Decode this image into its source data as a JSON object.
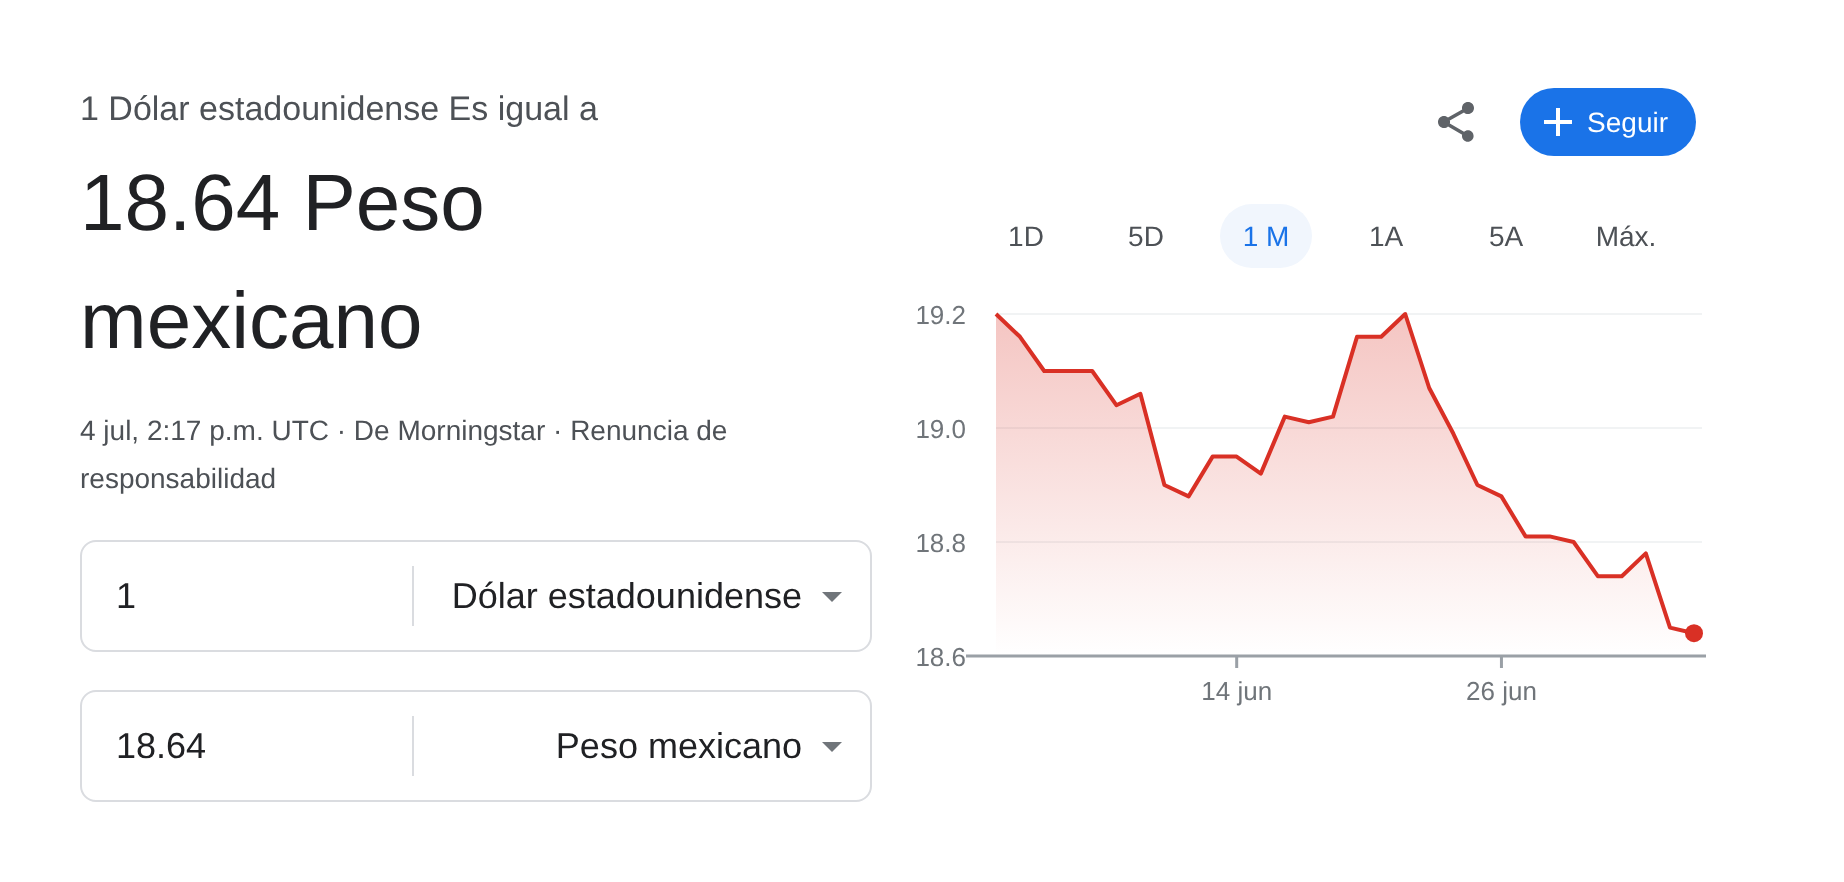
{
  "header": {
    "caption": "1 Dólar estadounidense Es igual a",
    "result": "18.64 Peso mexicano",
    "source": "4 jul, 2:17 p.m. UTC · De Morningstar · Renuncia de responsabilidad"
  },
  "follow_button": {
    "label": "Seguir"
  },
  "ranges": [
    {
      "label": "1D",
      "selected": false
    },
    {
      "label": "5D",
      "selected": false
    },
    {
      "label": "1 M",
      "selected": true
    },
    {
      "label": "1A",
      "selected": false
    },
    {
      "label": "5A",
      "selected": false
    },
    {
      "label": "Máx.",
      "selected": false
    }
  ],
  "converter": [
    {
      "value": "1",
      "currency": "Dólar estadounidense"
    },
    {
      "value": "18.64",
      "currency": "Peso mexicano"
    }
  ],
  "chart": {
    "chart_data": {
      "type": "area",
      "categories": [
        null,
        null,
        null,
        null,
        null,
        null,
        null,
        null,
        null,
        null,
        "14 jun",
        null,
        null,
        null,
        null,
        null,
        null,
        null,
        null,
        null,
        null,
        "26 jun",
        null,
        null,
        null,
        null,
        null,
        null,
        null,
        null
      ],
      "series": [
        {
          "color": "#d93025",
          "values": [
            19.2,
            19.16,
            19.1,
            19.1,
            19.1,
            19.04,
            19.06,
            18.9,
            18.88,
            18.95,
            18.95,
            18.92,
            19.02,
            19.01,
            19.02,
            19.16,
            19.16,
            19.2,
            19.07,
            18.99,
            18.9,
            18.88,
            18.81,
            18.81,
            18.8,
            18.74,
            18.74,
            18.78,
            18.65,
            18.64
          ]
        }
      ],
      "ylim": [
        18.6,
        19.2
      ],
      "yticks": [
        {
          "value": 18.6,
          "label": "18.6"
        },
        {
          "value": 18.8,
          "label": "18.8"
        },
        {
          "value": 19.0,
          "label": "19.0"
        },
        {
          "value": 19.2,
          "label": "19.2"
        }
      ]
    }
  }
}
